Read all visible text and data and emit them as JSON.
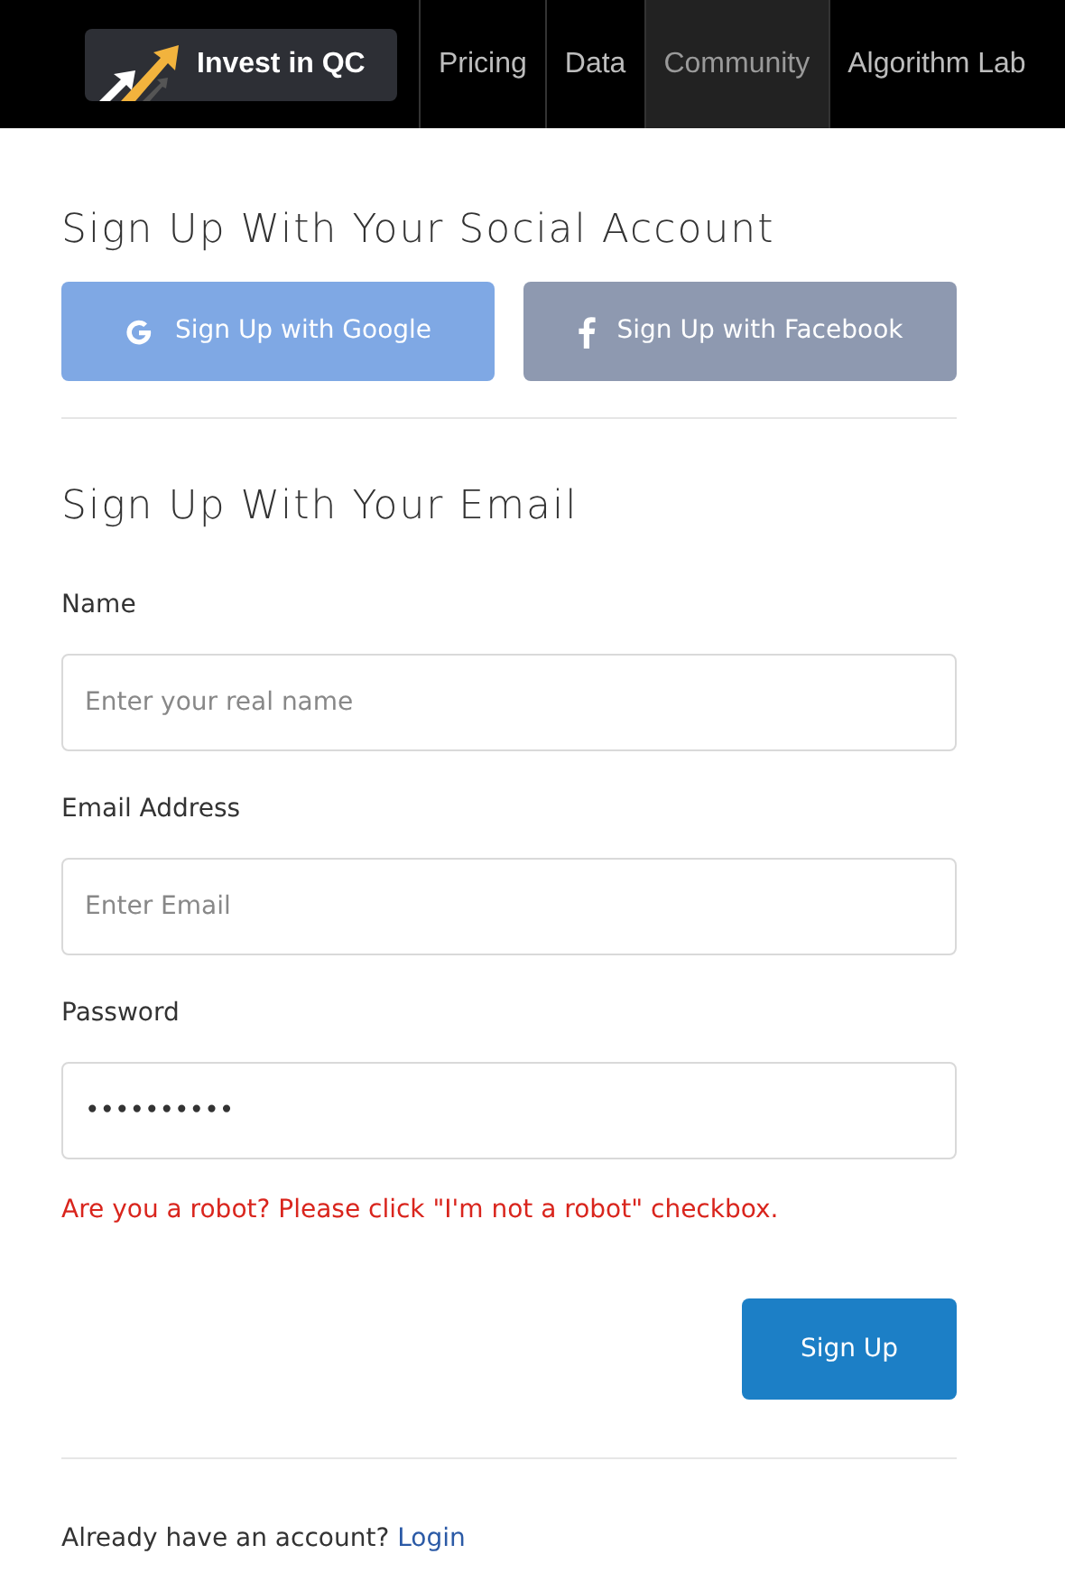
{
  "nav": {
    "logo": "Invest in QC",
    "items": [
      {
        "label": "Pricing",
        "selected": false
      },
      {
        "label": "Data",
        "selected": false
      },
      {
        "label": "Community",
        "selected": true
      },
      {
        "label": "Algorithm Lab",
        "selected": false
      }
    ]
  },
  "social": {
    "title": "Sign Up With Your Social Account",
    "buttons": [
      {
        "label": "Sign Up with Google",
        "kind": "google",
        "disabled": true
      },
      {
        "label": "Sign Up with Facebook",
        "kind": "facebook",
        "disabled": true
      }
    ]
  },
  "email": {
    "title": "Sign Up With Your Email",
    "fields": [
      {
        "label": "Name",
        "placeholder": "Enter your real name"
      },
      {
        "label": "Email Address",
        "placeholder": "Enter Email"
      },
      {
        "label": "Password",
        "value": "••••••••••"
      }
    ],
    "error": "Are you a robot? Please click \"I'm not a robot\" checkbox.",
    "submit": "Sign Up"
  },
  "footer": {
    "text": "Already have an account?",
    "link": "Login"
  }
}
